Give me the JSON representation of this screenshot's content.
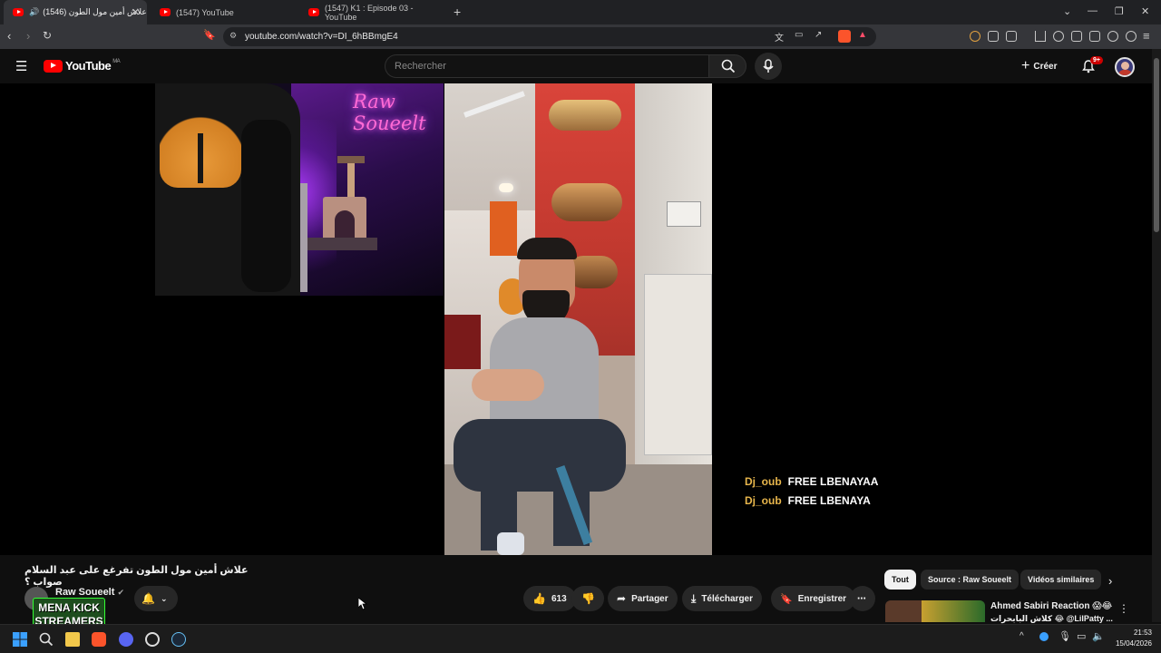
{
  "browser": {
    "tabs": [
      {
        "label": "(1546) علاش أمين مول الطون",
        "active": true
      },
      {
        "label": "(1547) YouTube",
        "active": false
      },
      {
        "label": "(1547) K1 : Episode 03 - YouTube",
        "active": false
      }
    ],
    "url": "youtube.com/watch?v=DI_6hBBmgE4"
  },
  "youtube": {
    "logo_text": "YouTube",
    "region": "MA",
    "search_placeholder": "Rechercher",
    "create_label": "Créer",
    "notif_count": "9+"
  },
  "video": {
    "cam_neon_text": "Raw Soueelt",
    "chat": [
      {
        "user": "Dj_oub",
        "message": "FREE LBENAYAA"
      },
      {
        "user": "Dj_oub",
        "message": "FREE LBENAYA"
      }
    ],
    "title": "علاش أمين مول الطون تفرغع على عبد السلام صواب ؟",
    "channel": "Raw Soueelt",
    "overlay_badge": "MENA KICK STREAMERS"
  },
  "actions": {
    "likes": "613",
    "share": "Partager",
    "download": "Télécharger",
    "save": "Enregistrer"
  },
  "chips": [
    "Tout",
    "Source : Raw Soueelt",
    "Vidéos similaires"
  ],
  "recommendation": {
    "title": "Ahmed Sabiri Reaction 😱😂",
    "subtitle": "كلاش البابحرات 😂 @LilPatty ..."
  },
  "taskbar": {
    "time": "21:53",
    "date": "15/04/2026"
  },
  "colors": {
    "youtube_red": "#ff0000",
    "chat_user": "#e8b64c",
    "page_bg": "#0f0f0f"
  }
}
